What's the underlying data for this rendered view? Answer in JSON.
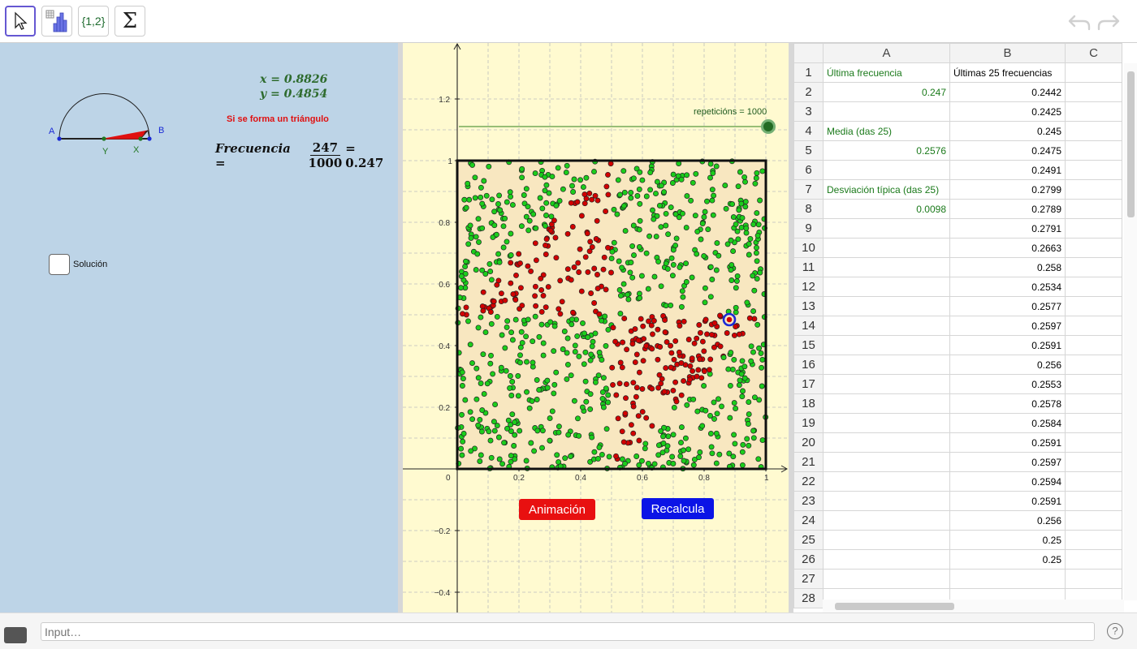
{
  "toolbar": {
    "list_tool_label": "{1,2}",
    "sigma_label": "Σ"
  },
  "left_panel": {
    "x_eq": "x = 0.8826",
    "y_eq": "y = 0.4854",
    "triangle_message": "Si se forma un triángulo",
    "freq_label": "Frecuencia =",
    "freq_num": "247",
    "freq_den": "1000",
    "freq_result": "= 0.247",
    "point_labels": {
      "A": "A",
      "B": "B",
      "X": "X",
      "Y": "Y"
    },
    "checkbox_label": "Solución"
  },
  "graph": {
    "slider_label": "repeticións = 1000",
    "btn_anim": "Animación",
    "btn_recalc": "Recalcula",
    "x_ticks": [
      "0",
      "0.2",
      "0.4",
      "0.6",
      "0.8",
      "1"
    ],
    "y_ticks": [
      "1.2",
      "1",
      "0.8",
      "0.6",
      "0.4",
      "0.2",
      "−0.2",
      "−0.4"
    ],
    "point_counts": {
      "total": 1000,
      "inside_red": 247
    },
    "colors": {
      "inside": "#d20000",
      "outside": "#1ccd1c",
      "square_fill": "#f8e7c0"
    }
  },
  "spreadsheet": {
    "columns": [
      "A",
      "B",
      "C"
    ],
    "rows": [
      {
        "n": "1",
        "a": "Última frecuencia",
        "b": "Últimas 25 frecuencias"
      },
      {
        "n": "2",
        "a": "0.247",
        "b": "0.2442"
      },
      {
        "n": "3",
        "a": "",
        "b": "0.2425"
      },
      {
        "n": "4",
        "a": "Media (das 25)",
        "b": "0.245"
      },
      {
        "n": "5",
        "a": "0.2576",
        "b": "0.2475"
      },
      {
        "n": "6",
        "a": "",
        "b": "0.2491"
      },
      {
        "n": "7",
        "a": "Desviación típica (das 25)",
        "b": "0.2799"
      },
      {
        "n": "8",
        "a": "0.0098",
        "b": "0.2789"
      },
      {
        "n": "9",
        "a": "",
        "b": "0.2791"
      },
      {
        "n": "10",
        "a": "",
        "b": "0.2663"
      },
      {
        "n": "11",
        "a": "",
        "b": "0.258"
      },
      {
        "n": "12",
        "a": "",
        "b": "0.2534"
      },
      {
        "n": "13",
        "a": "",
        "b": "0.2577"
      },
      {
        "n": "14",
        "a": "",
        "b": "0.2597"
      },
      {
        "n": "15",
        "a": "",
        "b": "0.2591"
      },
      {
        "n": "16",
        "a": "",
        "b": "0.256"
      },
      {
        "n": "17",
        "a": "",
        "b": "0.2553"
      },
      {
        "n": "18",
        "a": "",
        "b": "0.2578"
      },
      {
        "n": "19",
        "a": "",
        "b": "0.2584"
      },
      {
        "n": "20",
        "a": "",
        "b": "0.2591"
      },
      {
        "n": "21",
        "a": "",
        "b": "0.2597"
      },
      {
        "n": "22",
        "a": "",
        "b": "0.2594"
      },
      {
        "n": "23",
        "a": "",
        "b": "0.2591"
      },
      {
        "n": "24",
        "a": "",
        "b": "0.256"
      },
      {
        "n": "25",
        "a": "",
        "b": "0.25"
      },
      {
        "n": "26",
        "a": "",
        "b": "0.25"
      },
      {
        "n": "27",
        "a": "",
        "b": ""
      },
      {
        "n": "28",
        "a": "",
        "b": ""
      }
    ]
  },
  "input_bar": {
    "placeholder": "Input…",
    "help": "?"
  }
}
